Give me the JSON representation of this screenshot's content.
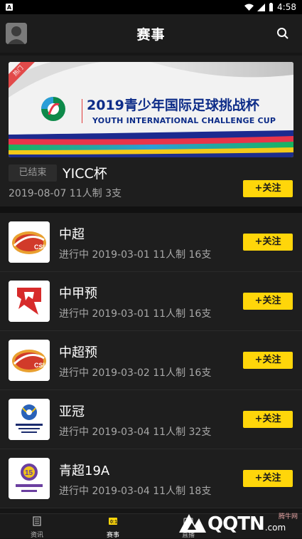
{
  "status_bar": {
    "time": "4:58"
  },
  "header": {
    "title": "赛事"
  },
  "featured": {
    "badge": "热门",
    "banner_title": "2019青少年国际足球挑战杯",
    "banner_subtitle": "YOUTH INTERNATIONAL CHALLENGE CUP",
    "status": "已结束",
    "name": "YICC杯",
    "meta": "2019-08-07 11人制 3支",
    "follow_label": "+关注"
  },
  "competitions": [
    {
      "name": "中超",
      "meta": "进行中 2019-03-01 11人制 16支",
      "follow_label": "+关注",
      "logo": "csl-logo"
    },
    {
      "name": "中甲预",
      "meta": "进行中 2019-03-01 11人制 16支",
      "follow_label": "+关注",
      "logo": "china-league-one-logo"
    },
    {
      "name": "中超预",
      "meta": "进行中 2019-03-02 11人制 16支",
      "follow_label": "+关注",
      "logo": "csl-logo"
    },
    {
      "name": "亚冠",
      "meta": "进行中 2019-03-04 11人制 32支",
      "follow_label": "+关注",
      "logo": "afc-champions-league-logo"
    },
    {
      "name": "青超19A",
      "meta": "进行中 2019-03-04 11人制 18支",
      "follow_label": "+关注",
      "logo": "nysl-logo"
    }
  ],
  "bottom_nav": [
    {
      "label": "资讯",
      "icon": "news-icon"
    },
    {
      "label": "赛事",
      "icon": "scoreboard-icon",
      "active": true
    },
    {
      "label": "直播",
      "icon": "live-icon"
    }
  ],
  "watermark": {
    "text": "QQTN",
    "suffix": ".com",
    "small": "腾牛网"
  },
  "colors": {
    "accent": "#ffd60a",
    "background": "#161616",
    "card": "#1e1e1e"
  }
}
